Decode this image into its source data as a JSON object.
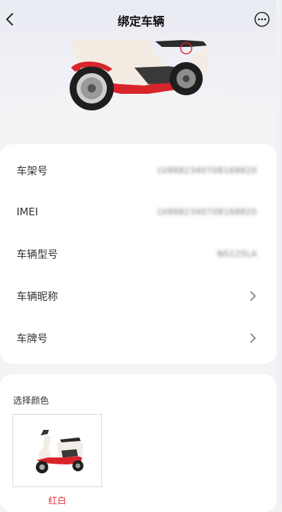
{
  "header": {
    "title": "绑定车辆",
    "back_icon": "chevron-left-icon",
    "more_icon": "more-circle-icon"
  },
  "vehicle_info": {
    "rows": [
      {
        "label": "车架号",
        "value": "LV8682340708168820",
        "type": "value"
      },
      {
        "label": "IMEI",
        "value": "LV8682340708168820",
        "type": "value"
      },
      {
        "label": "车辆型号",
        "value": "NS125LA",
        "type": "value"
      },
      {
        "label": "车辆昵称",
        "type": "arrow",
        "icon": "chevron-right-icon"
      },
      {
        "label": "车牌号",
        "type": "arrow",
        "icon": "chevron-right-icon"
      }
    ]
  },
  "color_selection": {
    "title": "选择颜色",
    "options": [
      {
        "label": "红白",
        "selected": true,
        "color": "#e0343c"
      }
    ]
  },
  "colors": {
    "accent_red": "#e0343c",
    "card_bg": "#ffffff",
    "page_bg": "#f3f3f5"
  }
}
